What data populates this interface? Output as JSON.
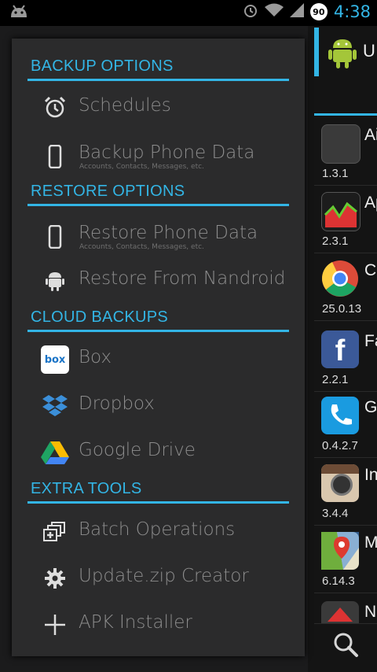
{
  "status_bar": {
    "time": "4:38",
    "battery": "90"
  },
  "drawer": {
    "sections": [
      {
        "title": "BACKUP OPTIONS"
      },
      {
        "title": "RESTORE OPTIONS"
      },
      {
        "title": "CLOUD BACKUPS"
      },
      {
        "title": "EXTRA TOOLS"
      }
    ],
    "items": {
      "schedules": {
        "label": "Schedules"
      },
      "backup_phone": {
        "label": "Backup Phone Data",
        "sub": "Accounts, Contacts, Messages, etc."
      },
      "restore_phone": {
        "label": "Restore Phone Data",
        "sub": "Accounts, Contacts, Messages, etc."
      },
      "restore_nandroid": {
        "label": "Restore From Nandroid"
      },
      "box": {
        "label": "Box"
      },
      "dropbox": {
        "label": "Dropbox"
      },
      "gdrive": {
        "label": "Google Drive"
      },
      "batch": {
        "label": "Batch Operations"
      },
      "updatezip": {
        "label": "Update.zip Creator"
      },
      "apk": {
        "label": "APK Installer"
      }
    }
  },
  "app_list": {
    "header_title": "U",
    "apps": [
      {
        "name": "Ai",
        "version": "1.3.1",
        "color": "#3a3a3a"
      },
      {
        "name": "Ap",
        "version": "2.3.1",
        "color": "#1f7a2a"
      },
      {
        "name": "Cl",
        "version": "25.0.13",
        "color": "#dd4b39"
      },
      {
        "name": "Fa",
        "version": "2.2.1",
        "color": "#3b5998"
      },
      {
        "name": "G",
        "version": "0.4.2.7",
        "color": "#1a9be0"
      },
      {
        "name": "In",
        "version": "3.4.4",
        "color": "#8a6a4f"
      },
      {
        "name": "M",
        "version": "6.14.3",
        "color": "#6fae3d"
      },
      {
        "name": "N",
        "version": "",
        "color": "#d33"
      }
    ]
  }
}
